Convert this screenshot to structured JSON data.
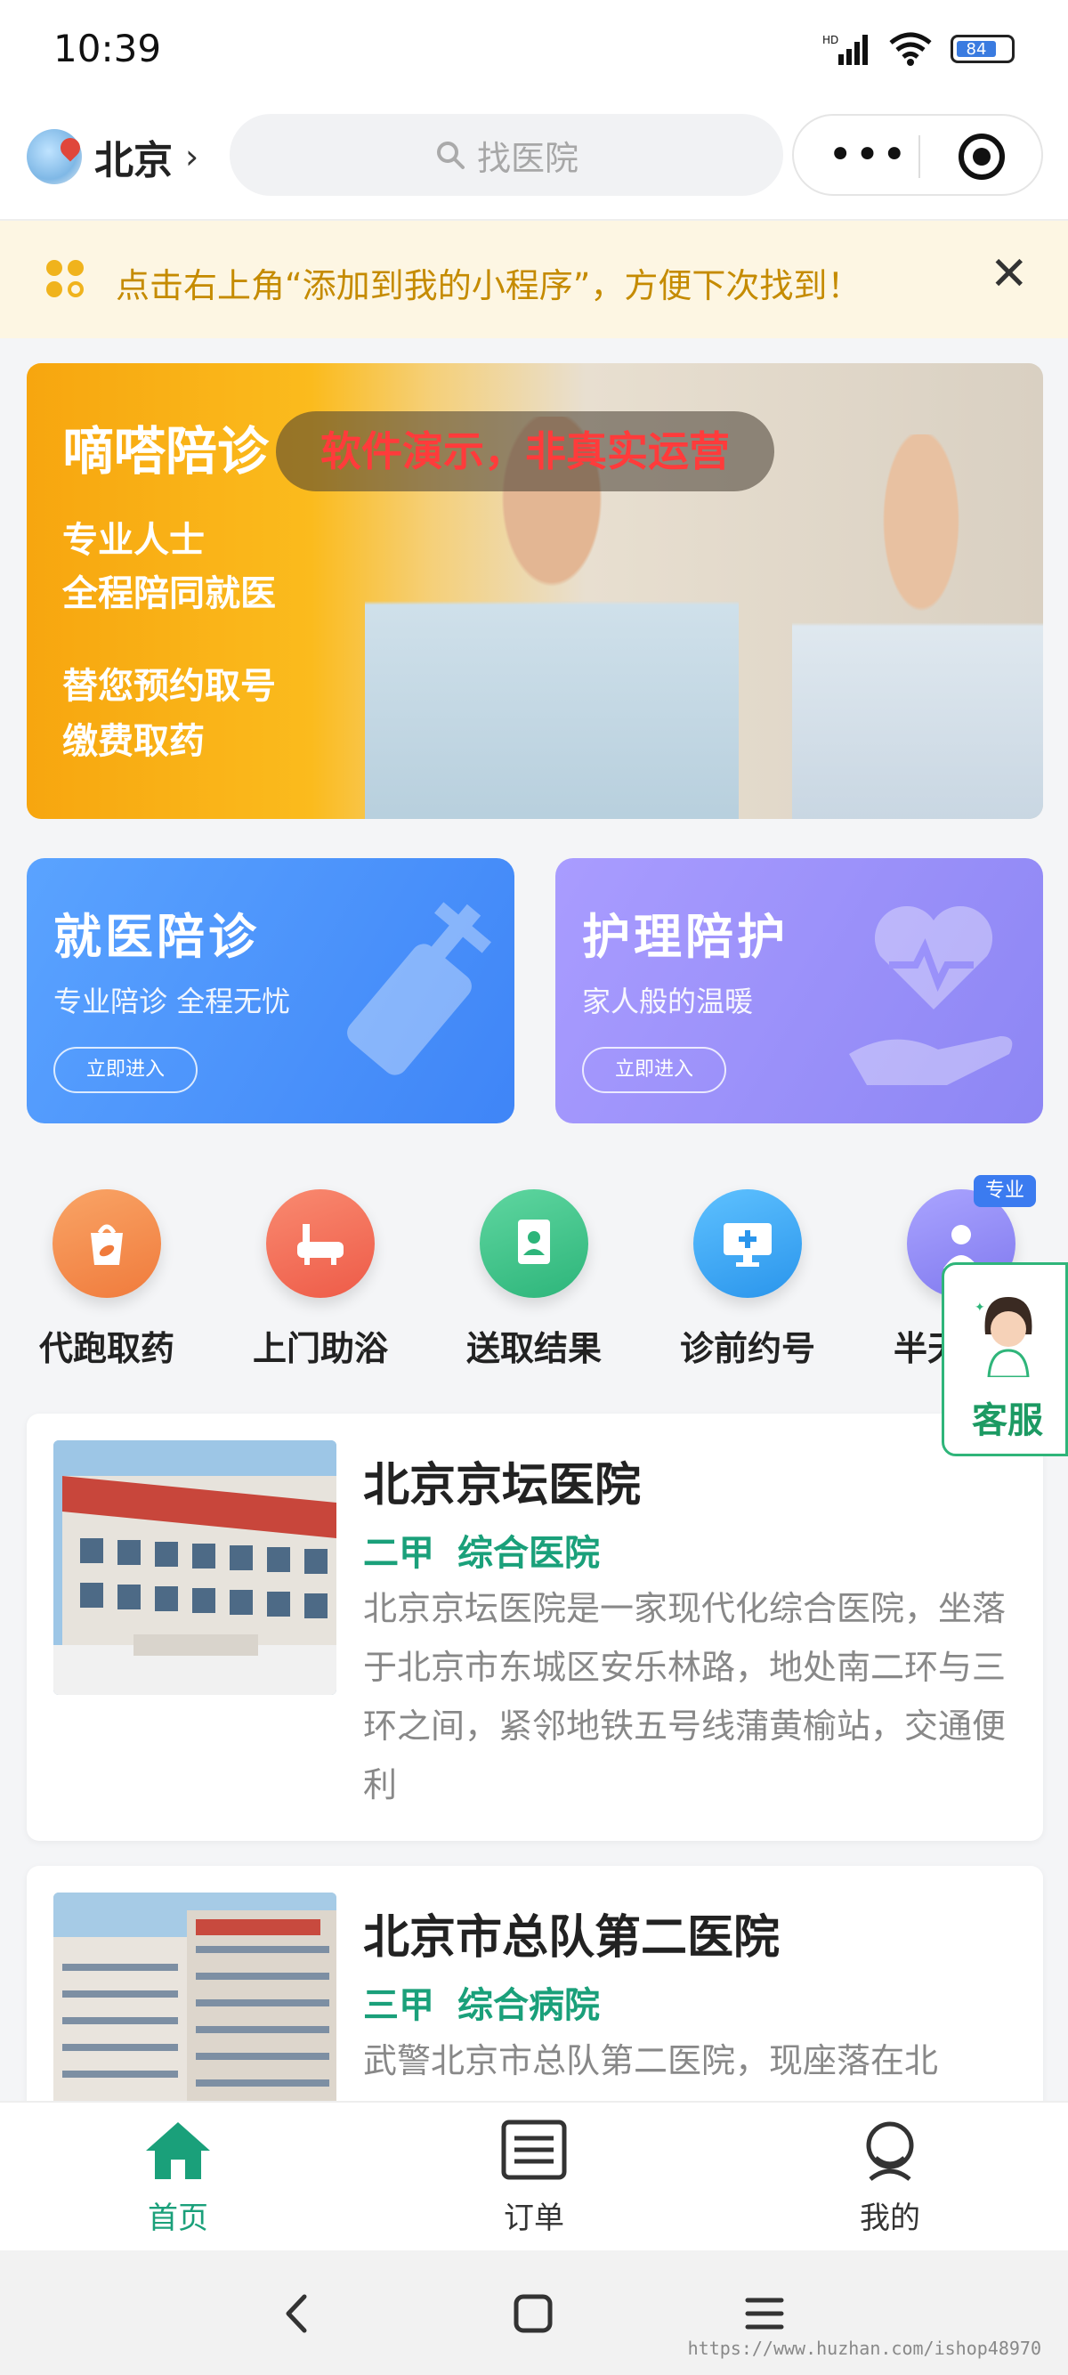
{
  "status_bar": {
    "time": "10:39",
    "battery": "84"
  },
  "nav": {
    "city": "北京",
    "search_placeholder": "找医院",
    "capsule_more": "•••"
  },
  "tip": {
    "text": "点击右上角“添加到我的小程序”，方便下次找到！",
    "close": "✕"
  },
  "banner": {
    "title": "嘀嗒陪诊",
    "line1": "专业人士",
    "line2": "全程陪同就医",
    "line3": "替您预约取号",
    "line4": "缴费取药",
    "overlay": "软件演示，非真实运营"
  },
  "services": [
    {
      "title": "就医陪诊",
      "subtitle": "专业陪诊 全程无忧",
      "button": "立即进入",
      "color": "#4a90f7"
    },
    {
      "title": "护理陪护",
      "subtitle": "家人般的温暖",
      "button": "立即进入",
      "color": "#9a90fa"
    }
  ],
  "grid": [
    {
      "label": "代跑取药",
      "icon": "medicine-bag-icon",
      "color": "#f3843f"
    },
    {
      "label": "上门助浴",
      "icon": "bathtub-icon",
      "color": "#f36d58"
    },
    {
      "label": "送取结果",
      "icon": "document-icon",
      "color": "#3dc48a"
    },
    {
      "label": "诊前约号",
      "icon": "monitor-icon",
      "color": "#2f9ff0"
    },
    {
      "label": "半天陪诊",
      "icon": "nurse-icon",
      "color": "#8b86f1"
    }
  ],
  "pro_badge": "专业",
  "customer_service": {
    "label": "客服"
  },
  "hospitals": [
    {
      "name": "北京京坛医院",
      "level": "二甲",
      "type": "综合医院",
      "description": "北京京坛医院是一家现代化综合医院，坐落于北京市东城区安乐林路，地处南二环与三环之间，紧邻地铁五号线蒲黄榆站，交通便利"
    },
    {
      "name": "北京市总队第二医院",
      "level": "三甲",
      "type": "综合病院",
      "description": "武警北京市总队第二医院，现座落在北"
    }
  ],
  "tabs": [
    {
      "label": "首页",
      "icon": "home-icon",
      "active": true
    },
    {
      "label": "订单",
      "icon": "order-list-icon",
      "active": false
    },
    {
      "label": "我的",
      "icon": "profile-icon",
      "active": false
    }
  ],
  "colors": {
    "primary": "#1aa07a",
    "tip_text": "#c58b00",
    "overlay_text": "#ff3b3b"
  },
  "watermark": "https://www.huzhan.com/ishop48970"
}
